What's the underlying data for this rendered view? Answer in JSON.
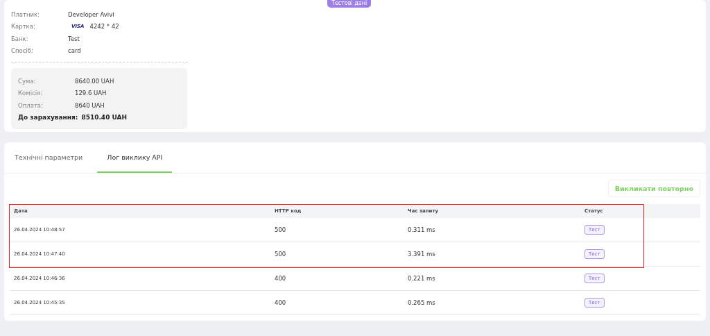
{
  "badge": "Тестові дані",
  "details": [
    {
      "label": "Платник:",
      "value": "Developer Avivi",
      "kind": "text"
    },
    {
      "label": "Картка:",
      "value": "4242 * 42",
      "kind": "card",
      "brand": "VISA"
    },
    {
      "label": "Банк:",
      "value": "Test",
      "kind": "text"
    },
    {
      "label": "Спосіб:",
      "value": "card",
      "kind": "text"
    }
  ],
  "summary": [
    {
      "label": "Сума:",
      "value": "8640.00 UAH",
      "total": false
    },
    {
      "label": "Комісія:",
      "value": "129.6 UAH",
      "total": false
    },
    {
      "label": "Оплата:",
      "value": "8640 UAH",
      "total": false
    },
    {
      "label": "До зарахування:",
      "value": "8510.40 UAH",
      "total": true
    }
  ],
  "tabs": [
    {
      "label": "Технічні параметри",
      "selected": false
    },
    {
      "label": "Лог виклику API",
      "selected": true
    }
  ],
  "retry_button": "Викликати повторно",
  "table": {
    "columns": [
      "Дата",
      "HTTP код",
      "Час запиту",
      "Статус"
    ],
    "rows": [
      {
        "date": "26.04.2024 10:48:57",
        "code": "500",
        "time": "0.311 ms",
        "status": "Тест",
        "marked": true
      },
      {
        "date": "26.04.2024 10:47:40",
        "code": "500",
        "time": "3.391 ms",
        "status": "Тест",
        "marked": true
      },
      {
        "date": "26.04.2024 10:46:36",
        "code": "400",
        "time": "0.221 ms",
        "status": "Тест",
        "marked": false
      },
      {
        "date": "26.04.2024 10:45:35",
        "code": "400",
        "time": "0.265 ms",
        "status": "Тест",
        "marked": false
      }
    ]
  }
}
